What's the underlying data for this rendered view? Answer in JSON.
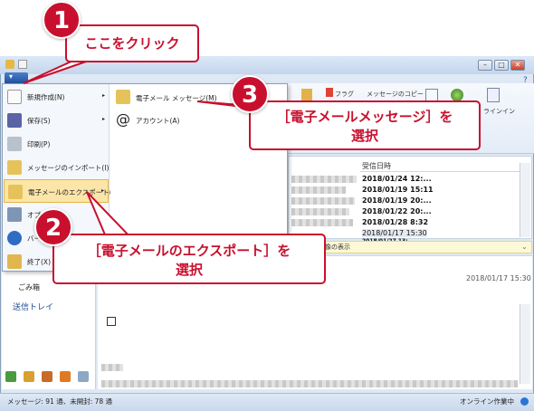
{
  "titlebar": {
    "min_glyph": "–",
    "max_glyph": "□",
    "close_glyph": "✕",
    "help_glyph": "?"
  },
  "app_button": {
    "glyph": "▾"
  },
  "ribbon": {
    "flag_label": "フラグ",
    "copy_label": "メッセージのコピー",
    "online_label": "ラインイン"
  },
  "message_list": {
    "column_header": "受信日時",
    "dates": [
      "2018/01/24 12:...",
      "2018/01/19 15:11",
      "2018/01/19 20:...",
      "2018/01/22 20:...",
      "2018/01/28 8:32",
      "2018/01/17 15:30",
      "2018/01/27 13:..."
    ]
  },
  "infobar": {
    "text": "像の表示"
  },
  "reading_pane": {
    "date": "2018/01/17 15:30"
  },
  "folders": {
    "trash": "ごみ箱",
    "sent": "送信トレイ"
  },
  "statusbar": {
    "left": "メッセージ: 91 通、未開封: 78 通",
    "right": "オンライン作業中"
  },
  "app_menu": {
    "items": [
      {
        "label": "新規作成(N)",
        "arrow": "▸"
      },
      {
        "label": "保存(S)",
        "arrow": "▸"
      },
      {
        "label": "印刷(P)",
        "arrow": ""
      },
      {
        "label": "メッセージのインポート(I)",
        "arrow": ""
      },
      {
        "label": "電子メールのエクスポート(E)",
        "arrow": "▸"
      },
      {
        "label": "オプ",
        "arrow": ""
      },
      {
        "label": "バー",
        "arrow": ""
      },
      {
        "label": "終了(X)",
        "arrow": ""
      }
    ],
    "submenu": [
      {
        "label": "電子メール メッセージ(M)"
      },
      {
        "label": "アカウント(A)"
      }
    ]
  },
  "callouts": {
    "step1": {
      "number": "1",
      "text": "ここをクリック"
    },
    "step2": {
      "number": "2",
      "line1": "［電子メールのエクスポート］を",
      "line2": "選択"
    },
    "step3": {
      "number": "3",
      "line1": "［電子メールメッセージ］を",
      "line2": "選択"
    }
  },
  "colors": {
    "callout_red": "#c8102e",
    "highlight": "#fbe5a8"
  }
}
